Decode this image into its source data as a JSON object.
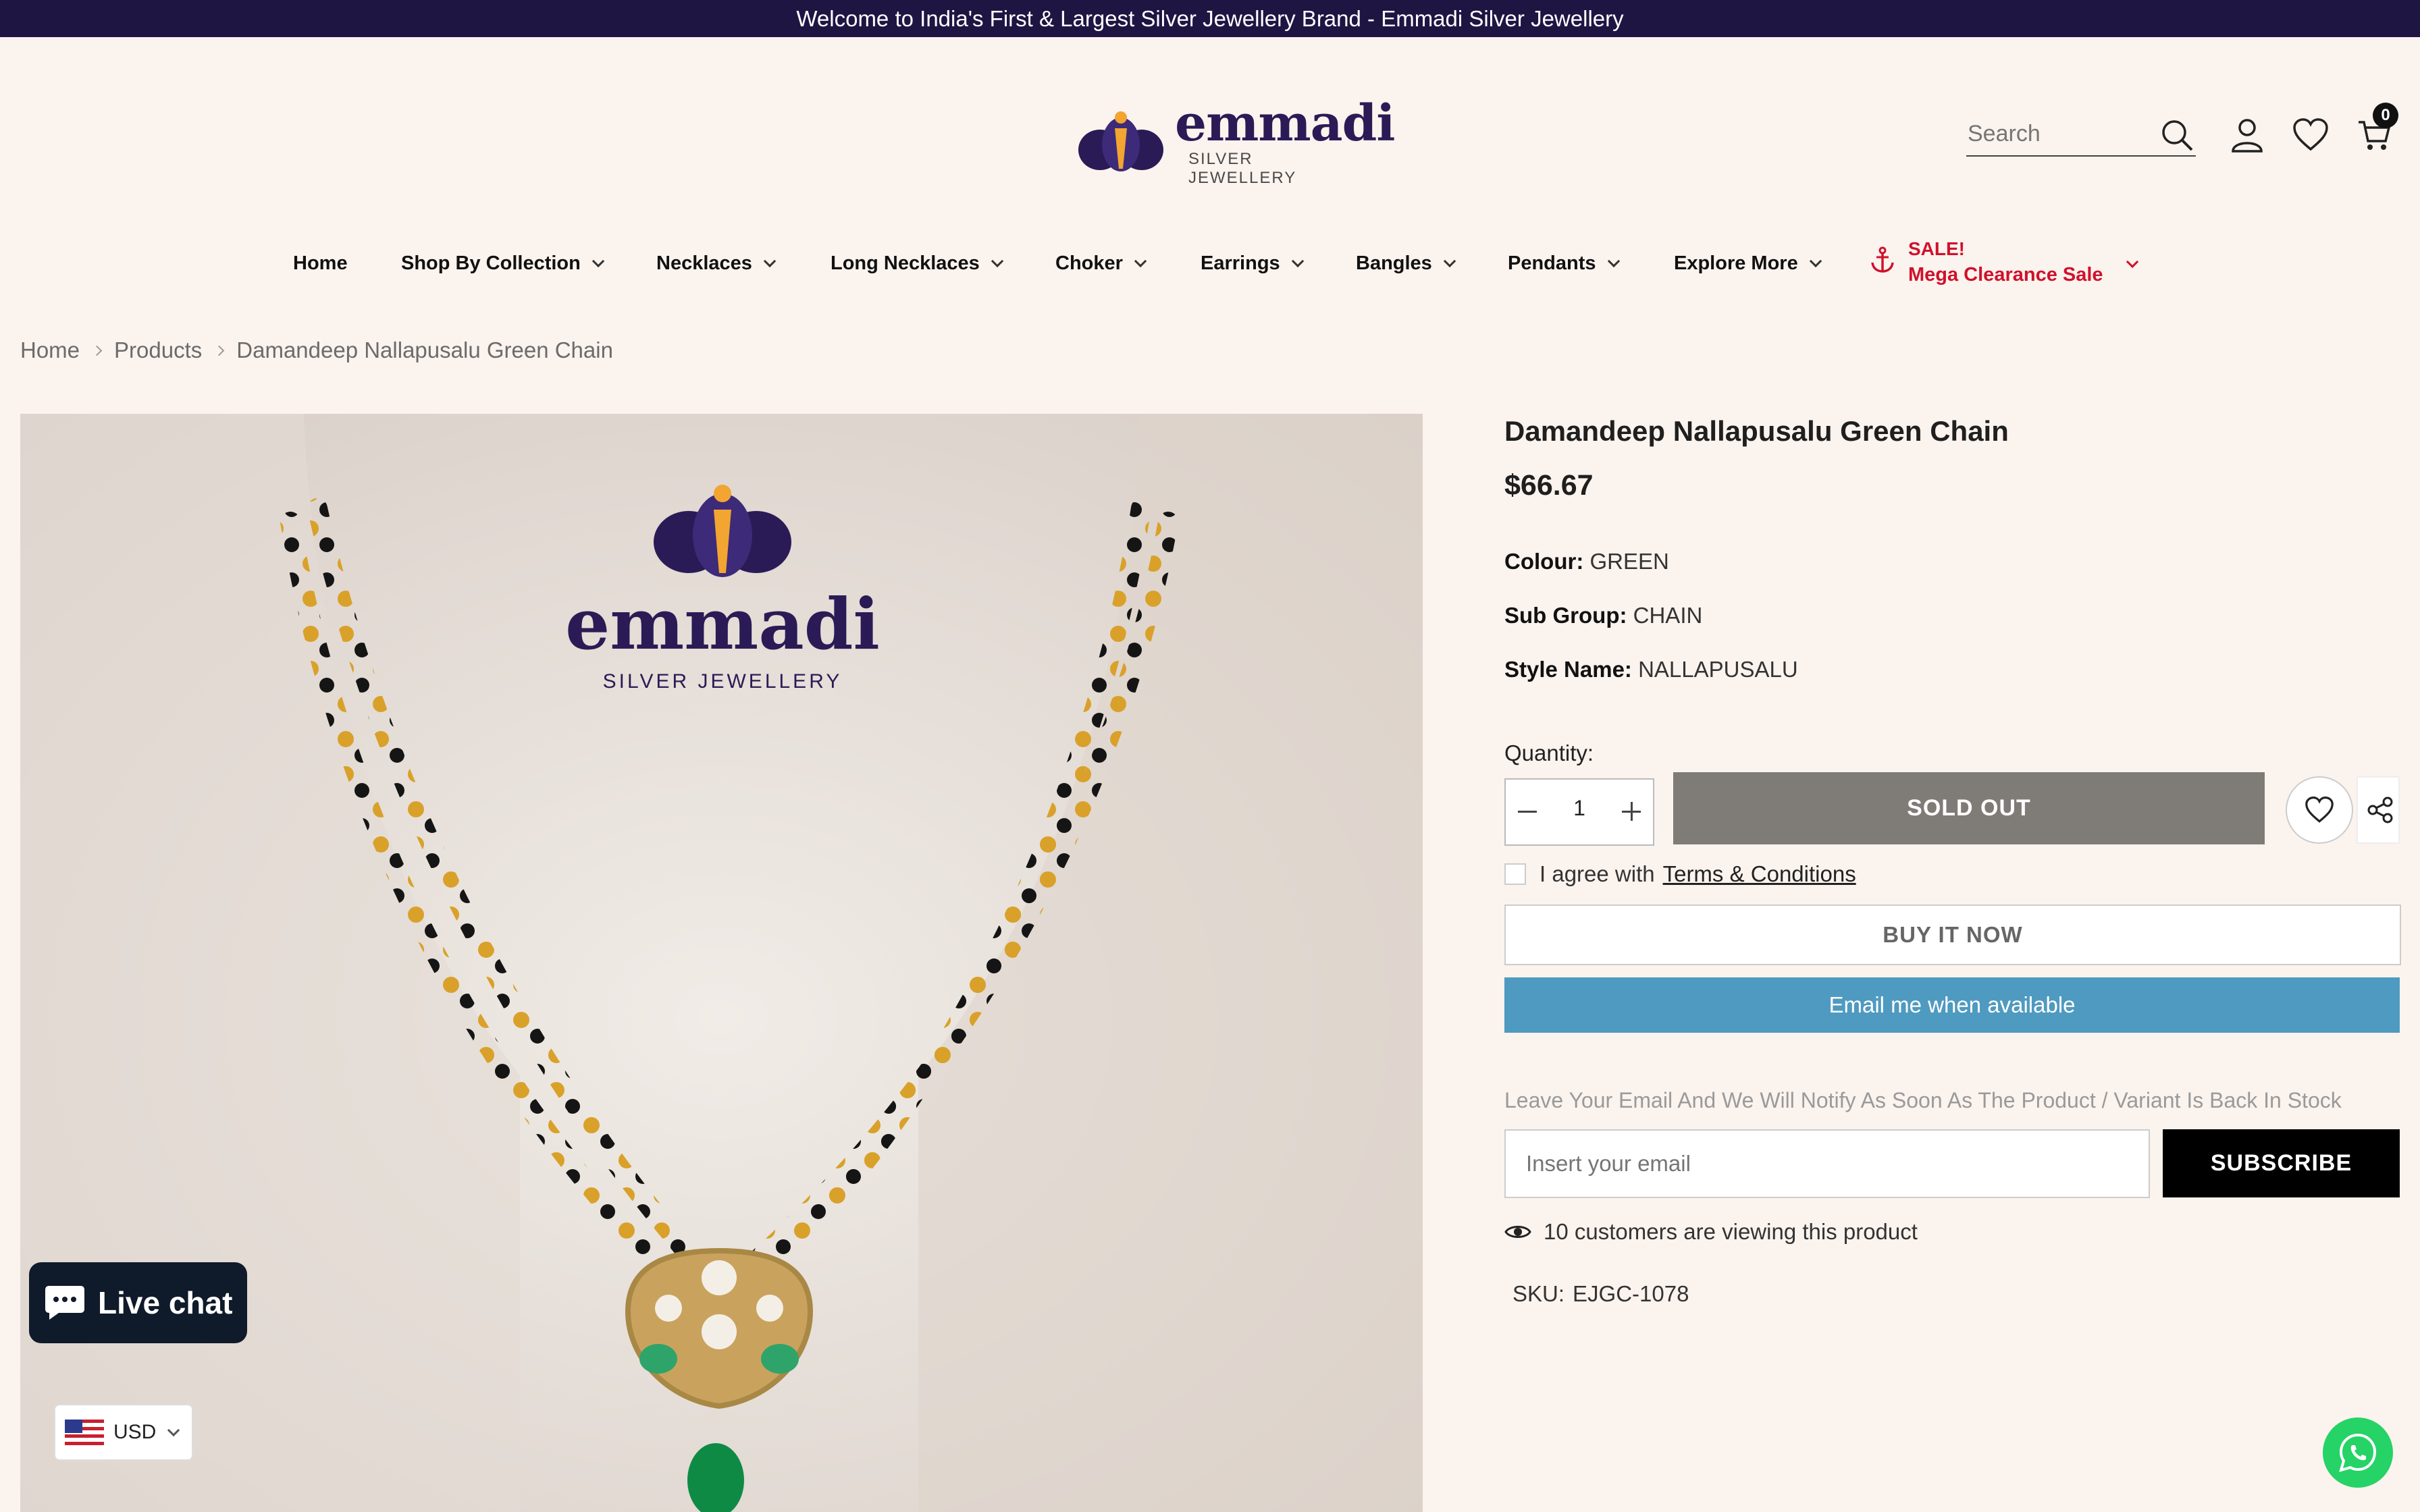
{
  "announcement": "Welcome to India's First & Largest Silver Jewellery Brand - Emmadi Silver Jewellery",
  "header": {
    "brand": "emmadi",
    "tagline": "SILVER JEWELLERY",
    "search_placeholder": "Search",
    "cart_count": "0"
  },
  "nav": {
    "items": [
      {
        "label": "Home"
      },
      {
        "label": "Shop By Collection"
      },
      {
        "label": "Necklaces"
      },
      {
        "label": "Long Necklaces"
      },
      {
        "label": "Choker"
      },
      {
        "label": "Earrings"
      },
      {
        "label": "Bangles"
      },
      {
        "label": "Pendants"
      },
      {
        "label": "Explore More"
      }
    ],
    "sale_line1": "SALE!",
    "sale_line2": "Mega Clearance Sale"
  },
  "breadcrumb": [
    "Home",
    "Products",
    "Damandeep Nallapusalu Green Chain"
  ],
  "product_image": {
    "brand": "emmadi",
    "tagline": "SILVER JEWELLERY"
  },
  "product": {
    "title": "Damandeep Nallapusalu Green Chain",
    "price": "$66.67",
    "attributes": [
      {
        "label": "Colour:",
        "value": "GREEN"
      },
      {
        "label": "Sub Group:",
        "value": "CHAIN"
      },
      {
        "label": "Style Name:",
        "value": "NALLAPUSALU"
      }
    ],
    "quantity_label": "Quantity:",
    "quantity": "1",
    "sold_out_label": "SOLD OUT",
    "agree_text": "I agree with",
    "terms_label": "Terms & Conditions",
    "buy_now_label": "BUY IT NOW",
    "notify_label": "Email me when available",
    "notify_text": "Leave Your Email And We Will Notify As Soon As The Product / Variant Is Back In Stock",
    "email_placeholder": "Insert your email",
    "subscribe_label": "SUBSCRIBE",
    "viewing_text": "10 customers are viewing this product",
    "sku_label": "SKU:",
    "sku_value": "EJGC-1078"
  },
  "widgets": {
    "live_chat_label": "Live chat",
    "currency": "USD"
  },
  "colors": {
    "announcement_bg": "#1f1543",
    "page_bg": "#fbf3ee",
    "sale_red": "#d0112b",
    "sold_out_bg": "#7f7b76",
    "notify_blue": "#4f9ac0",
    "whatsapp_green": "#25d366"
  }
}
